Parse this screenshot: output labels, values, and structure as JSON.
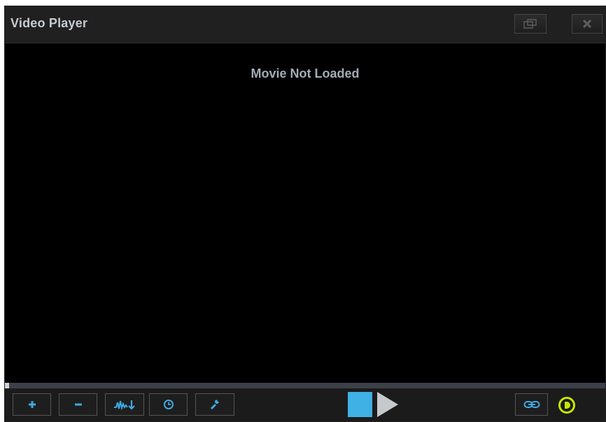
{
  "window": {
    "title": "Video Player",
    "restore_icon": "restore-window-icon",
    "close_icon": "close-icon"
  },
  "player": {
    "status": "Movie Not Loaded",
    "progress": 0
  },
  "controls": {
    "left_buttons": [
      {
        "name": "add-button",
        "icon": "plus-icon"
      },
      {
        "name": "remove-button",
        "icon": "minus-icon"
      },
      {
        "name": "waveform-button",
        "icon": "waveform-icon"
      },
      {
        "name": "clock-button",
        "icon": "clock-icon"
      },
      {
        "name": "settings-button",
        "icon": "wrench-icon"
      }
    ],
    "center_buttons": [
      {
        "name": "stop-button",
        "icon": "stop-icon"
      },
      {
        "name": "play-button",
        "icon": "play-icon"
      }
    ],
    "right_buttons": [
      {
        "name": "link-button",
        "icon": "link-icon"
      },
      {
        "name": "volume-button",
        "icon": "volume-icon"
      }
    ]
  },
  "colors": {
    "accent": "#3fb1e5",
    "volume": "#c8e600",
    "title_text": "#c7ccd2",
    "status_text": "#a3acb7"
  }
}
